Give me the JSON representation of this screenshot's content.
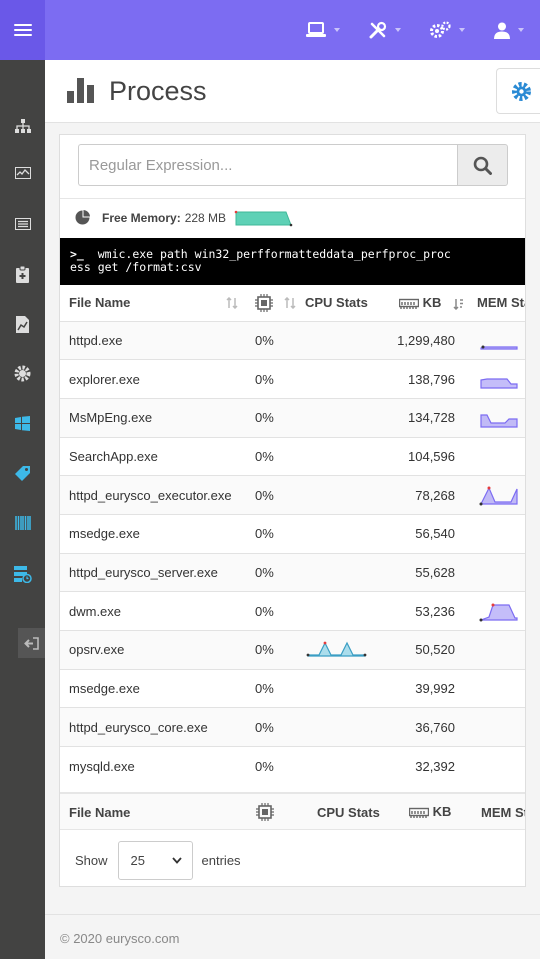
{
  "topbar": {
    "menus": [
      {
        "icon": "laptop-icon"
      },
      {
        "icon": "tools-icon"
      },
      {
        "icon": "gears-icon"
      },
      {
        "icon": "user-icon"
      }
    ]
  },
  "sidebar": {
    "items": [
      {
        "icon": "sitemap-icon"
      },
      {
        "icon": "chart-area-icon"
      },
      {
        "icon": "list-icon"
      },
      {
        "icon": "clipboard-icon"
      },
      {
        "icon": "file-chart-icon"
      },
      {
        "icon": "cog-icon"
      },
      {
        "icon": "windows-icon"
      },
      {
        "icon": "tags-icon"
      },
      {
        "icon": "barcode-icon"
      },
      {
        "icon": "server-clock-icon"
      }
    ],
    "exit_icon": "sign-out-icon"
  },
  "header": {
    "title": "Process",
    "title_icon": "bar-chart-icon",
    "settings_icon": "gear-icon"
  },
  "search": {
    "placeholder": "Regular Expression...",
    "button_icon": "search-icon"
  },
  "memory": {
    "label": "Free Memory:",
    "value": "228 MB",
    "icon": "pie-chart-icon",
    "spark_color": "#5ed1b6"
  },
  "command": {
    "prompt": ">_",
    "line1": "wmic.exe path win32_perfformatteddata_perfproc_proc",
    "line2": "ess get /format:csv"
  },
  "table": {
    "headers": {
      "name": "File Name",
      "cpu_icon": "cpu-icon",
      "stats": "CPU Stats",
      "kb_icon": "memory-icon",
      "kb": "KB",
      "mem": "MEM Stats"
    },
    "rows": [
      {
        "name": "httpd.exe",
        "cpu": "0%",
        "kb": "1,299,480"
      },
      {
        "name": "explorer.exe",
        "cpu": "0%",
        "kb": "138,796"
      },
      {
        "name": "MsMpEng.exe",
        "cpu": "0%",
        "kb": "134,728"
      },
      {
        "name": "SearchApp.exe",
        "cpu": "0%",
        "kb": "104,596"
      },
      {
        "name": "httpd_eurysco_executor.exe",
        "cpu": "0%",
        "kb": "78,268"
      },
      {
        "name": "msedge.exe",
        "cpu": "0%",
        "kb": "56,540"
      },
      {
        "name": "httpd_eurysco_server.exe",
        "cpu": "0%",
        "kb": "55,628"
      },
      {
        "name": "dwm.exe",
        "cpu": "0%",
        "kb": "53,236"
      },
      {
        "name": "opsrv.exe",
        "cpu": "0%",
        "kb": "50,520"
      },
      {
        "name": "msedge.exe",
        "cpu": "0%",
        "kb": "39,992"
      },
      {
        "name": "httpd_eurysco_core.exe",
        "cpu": "0%",
        "kb": "36,760"
      },
      {
        "name": "mysqld.exe",
        "cpu": "0%",
        "kb": "32,392"
      }
    ],
    "spark_color": "#7c6cf2"
  },
  "length": {
    "show_label": "Show",
    "value": "25",
    "entries_label": "entries"
  },
  "footer": {
    "copyright": "© 2020  eurysco.com"
  }
}
